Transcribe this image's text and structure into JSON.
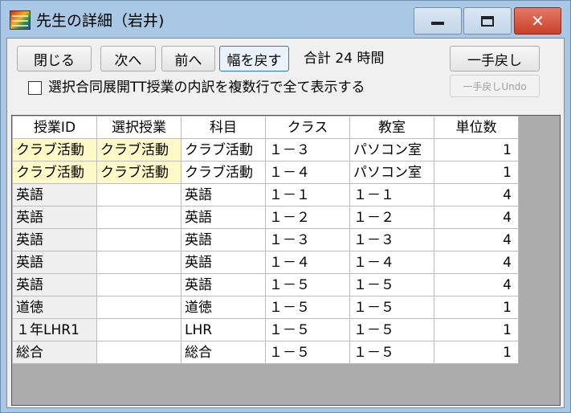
{
  "window": {
    "title": "先生の詳細（岩井)",
    "minimize": "minimize",
    "maximize": "maximize",
    "close": "close"
  },
  "toolbar": {
    "close_label": "閉じる",
    "next_label": "次へ",
    "prev_label": "前へ",
    "width_reset_label": "幅を戻す",
    "total_label": "合計 24 時間",
    "undo_label": "一手戻し",
    "undo_disabled_label": "一手戻しUndo"
  },
  "options": {
    "multiline_checkbox_label": "選択合同展開TT授業の内訳を複数行で全て表示する",
    "multiline_checked": false
  },
  "table": {
    "columns": [
      "授業ID",
      "選択授業",
      "科目",
      "クラス",
      "教室",
      "単位数"
    ],
    "rows": [
      {
        "id": "クラブ活動",
        "elective": "クラブ活動",
        "subject": "クラブ活動",
        "class": "１－３",
        "room": "パソコン室",
        "units": "1",
        "highlight": true
      },
      {
        "id": "クラブ活動",
        "elective": "クラブ活動",
        "subject": "クラブ活動",
        "class": "１－４",
        "room": "パソコン室",
        "units": "1",
        "highlight": true
      },
      {
        "id": "英語",
        "elective": "",
        "subject": "英語",
        "class": "１－１",
        "room": "１－１",
        "units": "4",
        "highlight": false
      },
      {
        "id": "英語",
        "elective": "",
        "subject": "英語",
        "class": "１－２",
        "room": "１－２",
        "units": "4",
        "highlight": false
      },
      {
        "id": "英語",
        "elective": "",
        "subject": "英語",
        "class": "１－３",
        "room": "１－３",
        "units": "4",
        "highlight": false
      },
      {
        "id": "英語",
        "elective": "",
        "subject": "英語",
        "class": "１－４",
        "room": "１－４",
        "units": "4",
        "highlight": false
      },
      {
        "id": "英語",
        "elective": "",
        "subject": "英語",
        "class": "１－５",
        "room": "１－５",
        "units": "4",
        "highlight": false
      },
      {
        "id": "道徳",
        "elective": "",
        "subject": "道徳",
        "class": "１－５",
        "room": "１－５",
        "units": "1",
        "highlight": false
      },
      {
        "id": "１年LHR1",
        "elective": "",
        "subject": "LHR",
        "class": "１－５",
        "room": "１－５",
        "units": "1",
        "highlight": false
      },
      {
        "id": "総合",
        "elective": "",
        "subject": "総合",
        "class": "１－５",
        "room": "１－５",
        "units": "1",
        "highlight": false
      }
    ]
  },
  "colors": {
    "title_bar": "#a9c8e6",
    "highlight_cell": "#fff9c8",
    "grid_background": "#ababab",
    "close_button": "#c8402a"
  }
}
